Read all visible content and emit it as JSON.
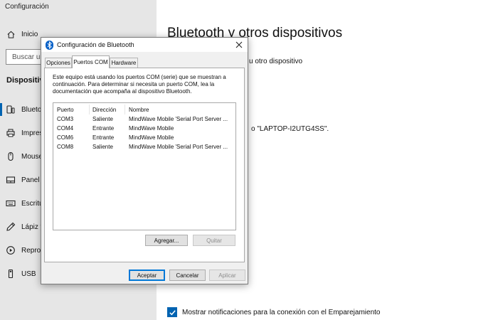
{
  "app": {
    "title": "Configuración"
  },
  "sidebar": {
    "home_label": "Inicio",
    "search_placeholder": "Buscar un",
    "section_title": "Dispositivos",
    "items": [
      {
        "label": "Blueto",
        "icon": "bluetooth-devices-icon",
        "selected": true
      },
      {
        "label": "Impres",
        "icon": "printer-icon"
      },
      {
        "label": "Mouse",
        "icon": "mouse-icon"
      },
      {
        "label": "Panel t",
        "icon": "touchpad-icon"
      },
      {
        "label": "Escritu",
        "icon": "keyboard-icon"
      },
      {
        "label": "Lápiz y",
        "icon": "pen-icon"
      },
      {
        "label": "Repro",
        "icon": "autoplay-icon"
      },
      {
        "label": "USB",
        "icon": "usb-icon"
      }
    ]
  },
  "main": {
    "title": "Bluetooth y otros dispositivos",
    "add_device_text": "u otro dispositivo",
    "laptop_text": "o \"LAPTOP-I2UTG4SS\".",
    "notifications_label": "Mostrar notificaciones para la conexión con el Emparejamiento",
    "notifications_checked": true
  },
  "dialog": {
    "title": "Configuración de Bluetooth",
    "tabs": [
      {
        "label": "Opciones",
        "active": false
      },
      {
        "label": "Puertos COM",
        "active": true
      },
      {
        "label": "Hardware",
        "active": false
      }
    ],
    "description": "Este equipo está usando los puertos COM (serie) que se muestran a continuación. Para determinar si necesita un puerto COM, lea la documentación que acompaña al dispositivo Bluetooth.",
    "columns": [
      "Puerto",
      "Dirección",
      "Nombre"
    ],
    "rows": [
      {
        "port": "COM3",
        "direction": "Saliente",
        "name": "MindWave Mobile 'Serial Port Server ..."
      },
      {
        "port": "COM4",
        "direction": "Entrante",
        "name": "MindWave Mobile"
      },
      {
        "port": "COM6",
        "direction": "Entrante",
        "name": "MindWave Mobile"
      },
      {
        "port": "COM8",
        "direction": "Saliente",
        "name": "MindWave Mobile 'Serial Port Server ..."
      }
    ],
    "add_button": "Agregar...",
    "remove_button": "Quitar",
    "accept_button": "Aceptar",
    "cancel_button": "Cancelar",
    "apply_button": "Aplicar"
  },
  "colors": {
    "accent": "#0063b1",
    "sidebar_bg": "#e6e6e6",
    "dialog_bg": "#f0f0f0"
  }
}
